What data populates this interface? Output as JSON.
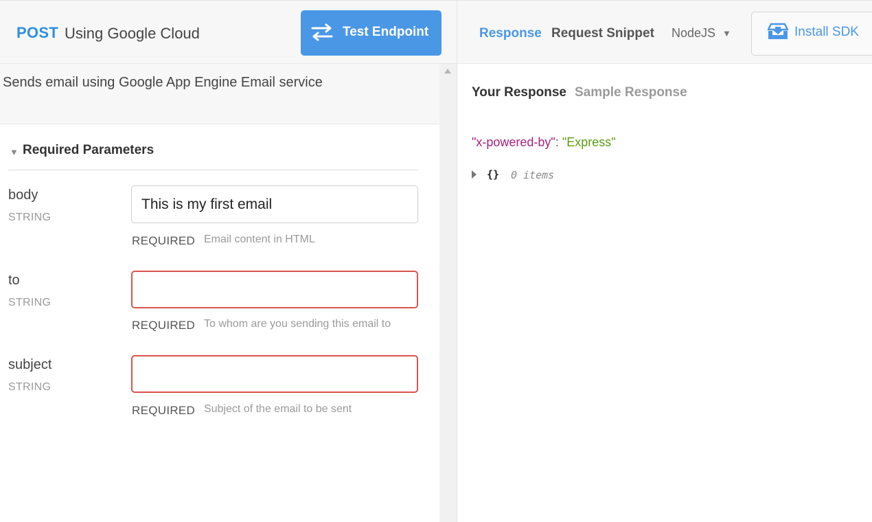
{
  "endpoint": {
    "method": "POST",
    "title": "Using Google Cloud",
    "test_button_label": "Test Endpoint",
    "description": "Sends email using Google App Engine Email service"
  },
  "params_section": {
    "title": "Required Parameters",
    "params": [
      {
        "name": "body",
        "type": "STRING",
        "value": "This is my first email",
        "required_label": "REQUIRED",
        "help": "Email content in HTML",
        "invalid": false
      },
      {
        "name": "to",
        "type": "STRING",
        "value": "",
        "required_label": "REQUIRED",
        "help": "To whom are you sending this email to",
        "invalid": true
      },
      {
        "name": "subject",
        "type": "STRING",
        "value": "",
        "required_label": "REQUIRED",
        "help": "Subject of the email to be sent",
        "invalid": true
      }
    ]
  },
  "right_panel": {
    "tabs": {
      "response": "Response",
      "snippet": "Request Snippet"
    },
    "language": "NodeJS",
    "install_sdk": "Install SDK",
    "subtabs": {
      "your_response": "Your Response",
      "sample_response": "Sample Response"
    },
    "response_header": {
      "key": "\"x-powered-by\"",
      "colon": ": ",
      "value": "\"Express\""
    },
    "json_preview": {
      "brace": "{}",
      "count": "0 items"
    }
  },
  "colors": {
    "accent": "#4a97e6",
    "method": "#2e8fe0",
    "invalid_border": "#d9534f",
    "json_key": "#a6227e",
    "json_string": "#5b9a12"
  },
  "icons": {
    "test_button": "swap-arrows-icon",
    "install_sdk": "download-tray-icon",
    "collapse": "triangle-down-icon",
    "language_dropdown": "caret-down-icon",
    "json_expand": "triangle-right-icon",
    "scroll_up": "scroll-up-arrow-icon"
  }
}
